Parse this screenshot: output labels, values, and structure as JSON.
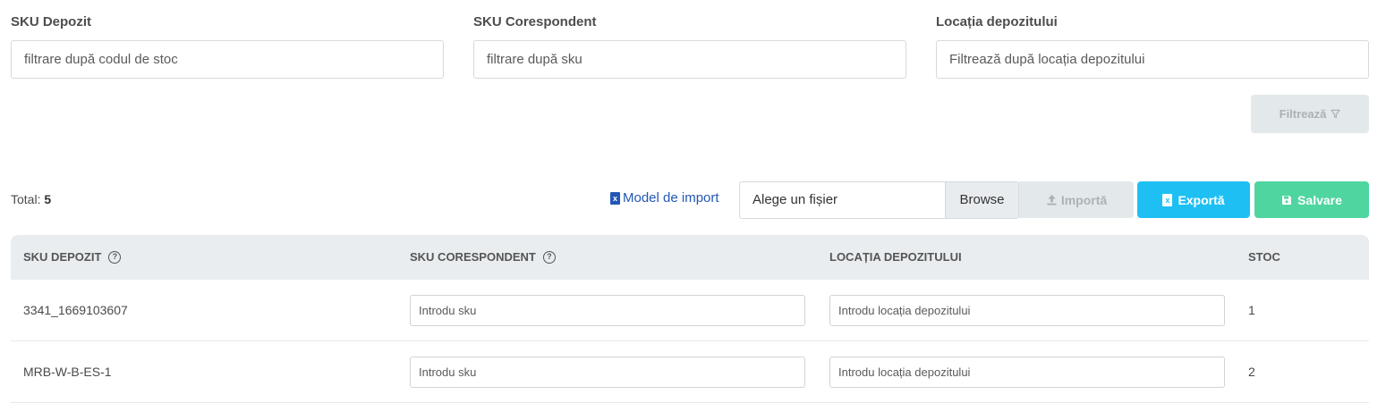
{
  "filters": {
    "sku_depozit": {
      "label": "SKU Depozit",
      "placeholder": "filtrare după codul de stoc"
    },
    "sku_corespondent": {
      "label": "SKU Corespondent",
      "placeholder": "filtrare după sku"
    },
    "locatie": {
      "label": "Locația depozitului",
      "placeholder": "Filtrează după locația depozitului"
    },
    "filter_button": "Filtrează"
  },
  "toolbar": {
    "total_label": "Total:",
    "total_value": "5",
    "model_import": "Model de import",
    "file_placeholder": "Alege un fișier",
    "browse": "Browse",
    "import": "Importă",
    "export": "Exportă",
    "save": "Salvare"
  },
  "table": {
    "headers": {
      "sku_depozit": "SKU DEPOZIT",
      "sku_corespondent": "SKU CORESPONDENT",
      "locatie": "LOCAȚIA DEPOZITULUI",
      "stoc": "STOC"
    },
    "rows": [
      {
        "sku": "3341_1669103607",
        "sku_placeholder": "Introdu sku",
        "loc_placeholder": "Introdu locația depozitului",
        "stoc": "1"
      },
      {
        "sku": "MRB-W-B-ES-1",
        "sku_placeholder": "Introdu sku",
        "loc_placeholder": "Introdu locația depozitului",
        "stoc": "2"
      }
    ]
  },
  "colors": {
    "export": "#1ec0f4",
    "save": "#4fd5a0",
    "link": "#2257b5",
    "disabled": "#e3e9ea"
  },
  "icons": [
    "filter-icon",
    "excel-icon",
    "upload-icon",
    "save-icon",
    "help-circle-icon"
  ]
}
